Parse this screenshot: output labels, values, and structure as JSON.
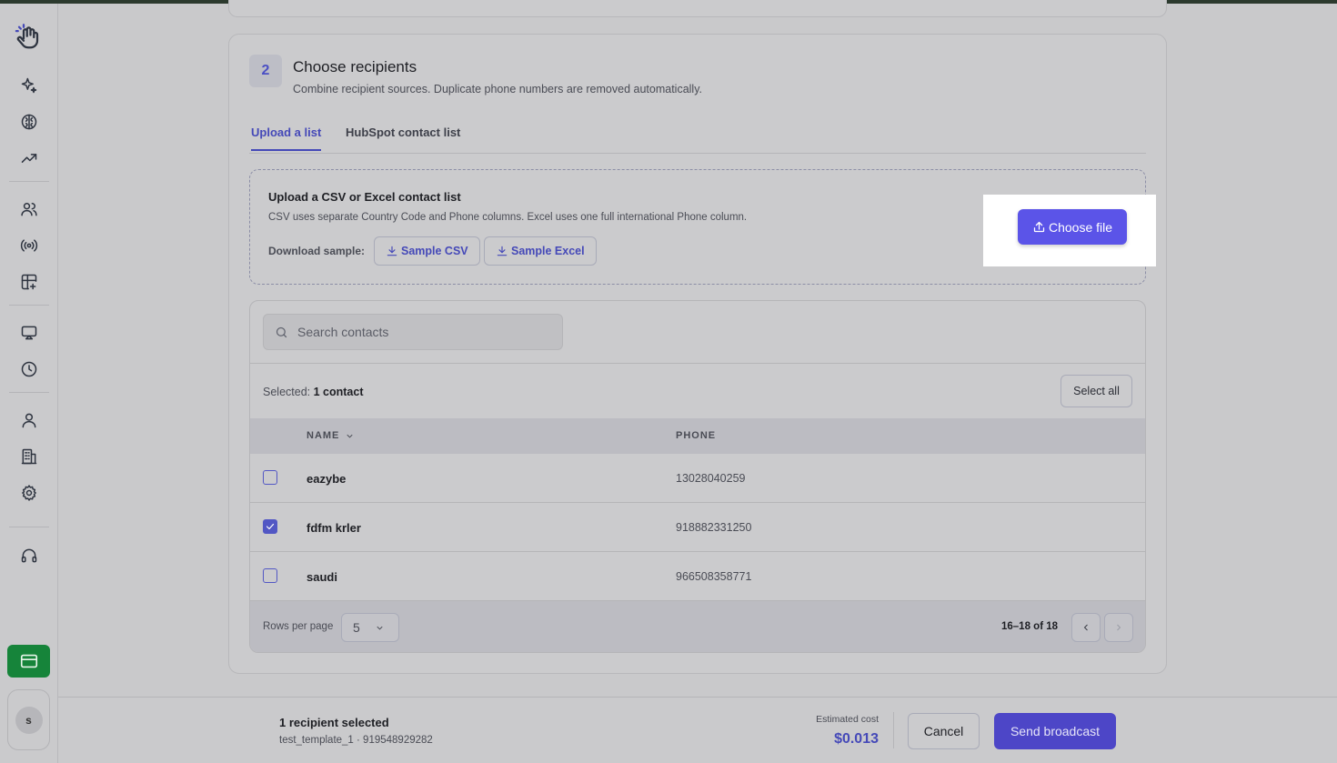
{
  "step": {
    "number": "2",
    "title": "Choose recipients",
    "subtitle": "Combine recipient sources. Duplicate phone numbers are removed automatically."
  },
  "tabs": [
    {
      "label": "Upload a list",
      "active": true
    },
    {
      "label": "HubSpot contact list",
      "active": false
    }
  ],
  "upload": {
    "title": "Upload a CSV or Excel contact list",
    "description": "CSV uses separate Country Code and Phone columns. Excel uses one full international Phone column.",
    "download_label": "Download sample:",
    "sample_csv_label": "Sample CSV",
    "sample_excel_label": "Sample Excel",
    "choose_file_label": "Choose file"
  },
  "contacts": {
    "search_placeholder": "Search contacts",
    "selected_prefix": "Selected:",
    "selected_value": "1 contact",
    "select_all_label": "Select all",
    "columns": {
      "name": "NAME",
      "phone": "PHONE"
    },
    "rows": [
      {
        "name": "eazybe",
        "phone": "13028040259",
        "checked": false
      },
      {
        "name": "fdfm krler",
        "phone": "918882331250",
        "checked": true
      },
      {
        "name": "saudi",
        "phone": "966508358771",
        "checked": false
      }
    ],
    "rows_per_page_label": "Rows per page",
    "rows_per_page_value": "5",
    "page_info": "16–18 of 18"
  },
  "footer": {
    "recipient_count": "1 recipient selected",
    "recipient_detail": "test_template_1 · 919548929282",
    "cost_label": "Estimated cost",
    "cost_value": "$0.013",
    "cancel_label": "Cancel",
    "send_label": "Send broadcast"
  },
  "sidebar": {
    "avatar_initial": "s",
    "icons": [
      "hand-logo-icon",
      "sparkles-icon",
      "brain-icon",
      "trending-icon",
      "users-icon",
      "broadcast-icon",
      "layout-plus-icon",
      "monitor-icon",
      "clock-icon",
      "user-icon",
      "building-icon",
      "gear-icon",
      "headphones-icon",
      "credit-card-icon"
    ]
  },
  "colors": {
    "accent": "#4549b8",
    "primary_button": "#5b54e8",
    "send_button": "#4d46c7",
    "billing_green": "#16843a"
  }
}
